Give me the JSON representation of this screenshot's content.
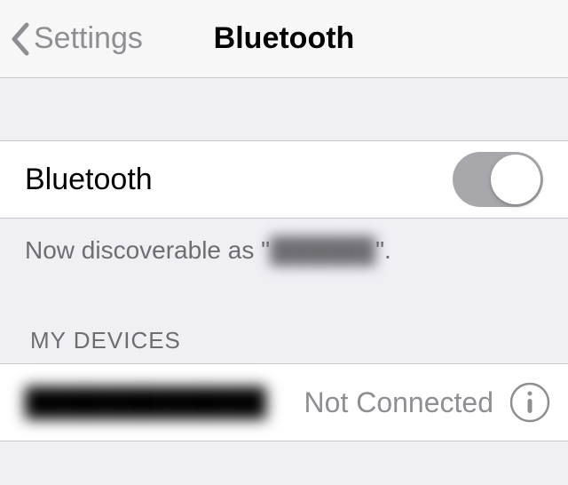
{
  "nav": {
    "back_label": "Settings",
    "title": "Bluetooth"
  },
  "bluetooth_row": {
    "label": "Bluetooth",
    "enabled": true
  },
  "discoverable": {
    "prefix": "Now discoverable as \"",
    "name": "██████",
    "suffix": "\"."
  },
  "devices": {
    "header": "MY DEVICES",
    "items": [
      {
        "name": "████████████",
        "status": "Not Connected"
      }
    ]
  }
}
